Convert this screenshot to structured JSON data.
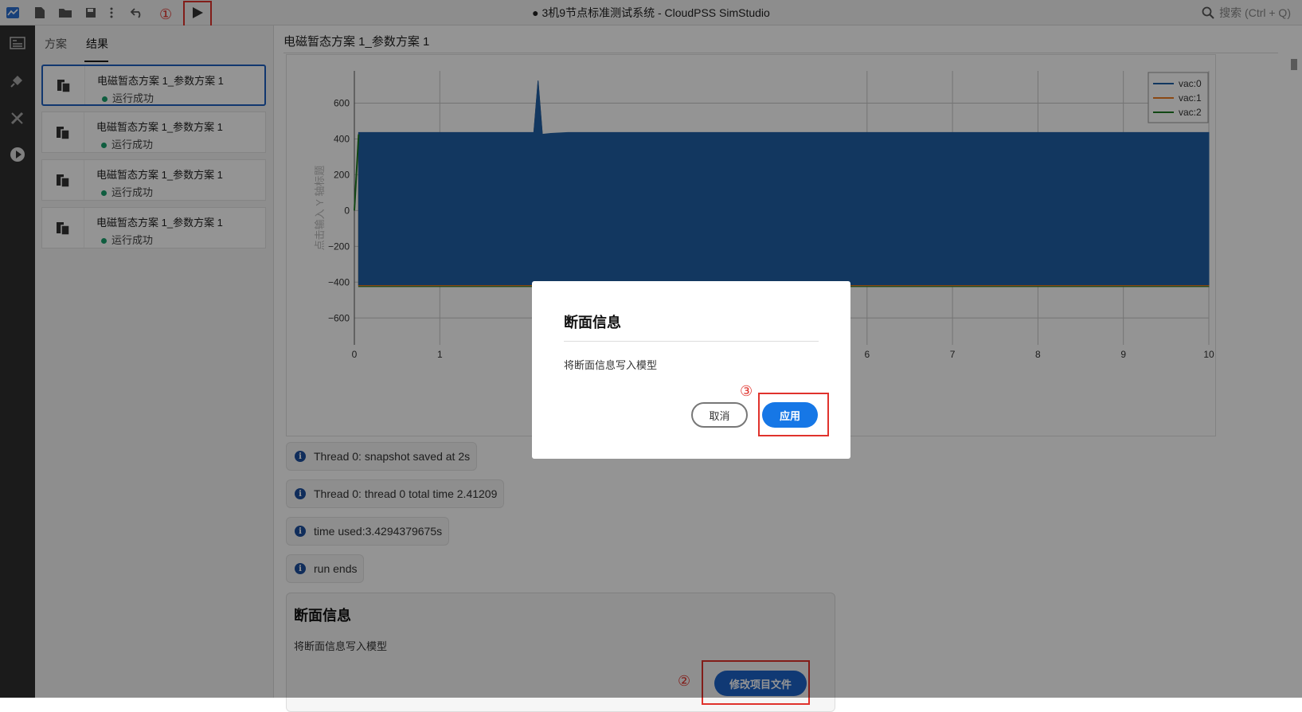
{
  "app": {
    "title": "● 3机9节点标准测试系统 - CloudPSS SimStudio",
    "search_placeholder": "搜索 (Ctrl + Q)"
  },
  "toolbar": {
    "annotation": "①"
  },
  "left_panel": {
    "tabs": [
      {
        "label": "方案"
      },
      {
        "label": "结果"
      }
    ],
    "results": [
      {
        "name": "电磁暂态方案 1_参数方案 1",
        "status": "运行成功"
      },
      {
        "name": "电磁暂态方案 1_参数方案 1",
        "status": "运行成功"
      },
      {
        "name": "电磁暂态方案 1_参数方案 1",
        "status": "运行成功"
      },
      {
        "name": "电磁暂态方案 1_参数方案 1",
        "status": "运行成功"
      }
    ]
  },
  "main": {
    "title": "电磁暂态方案 1_参数方案 1",
    "logs": [
      {
        "text": "Thread 0: snapshot saved at 2s"
      },
      {
        "text": "Thread 0: thread 0 total time 2.41209"
      },
      {
        "text": "time used:3.4294379675s"
      },
      {
        "text": "run ends"
      }
    ],
    "snapshot_card": {
      "title": "断面信息",
      "text": "将断面信息写入模型",
      "button": "修改项目文件",
      "annotation": "②"
    }
  },
  "chart_data": {
    "type": "line",
    "ylabel": "点击输入 Y 轴标题",
    "xlim": [
      0,
      10
    ],
    "ylim": [
      -750,
      780
    ],
    "x_ticks": [
      0,
      1,
      6,
      7,
      8,
      9,
      10
    ],
    "y_ticks": [
      600,
      400,
      200,
      0,
      -200,
      -400,
      -600
    ],
    "x_tick_labels": [
      "0",
      "1",
      "6",
      "7",
      "8",
      "9",
      "10"
    ],
    "y_tick_labels": [
      "600",
      "400",
      "200",
      "0",
      "−200",
      "−400",
      "−600"
    ],
    "legend": "top-right",
    "grid": true,
    "series": [
      {
        "name": "vac:0",
        "color": "#1f5fa6",
        "envelope": {
          "x": [
            0.05,
            2.1,
            2.15,
            2.2,
            2.3,
            2.5,
            10
          ],
          "upper": [
            425,
            425,
            715,
            415,
            420,
            425,
            425
          ],
          "lower": [
            -425,
            -425,
            -425,
            -425,
            -425,
            -425,
            -425
          ]
        }
      },
      {
        "name": "vac:1",
        "color": "#ef7d22",
        "envelope": {
          "x": [
            0.05,
            2.1,
            2.15,
            2.2,
            2.3,
            2.5,
            10
          ],
          "upper": [
            425,
            425,
            715,
            415,
            420,
            425,
            425
          ],
          "lower": [
            -425,
            -425,
            -425,
            -425,
            -425,
            -425,
            -425
          ]
        }
      },
      {
        "name": "vac:2",
        "color": "#1e7a24",
        "envelope": {
          "x": [
            0.05,
            2.1,
            2.15,
            2.2,
            2.3,
            2.5,
            10
          ],
          "upper": [
            425,
            425,
            715,
            415,
            420,
            425,
            425
          ],
          "lower": [
            -425,
            -425,
            -425,
            -425,
            -425,
            -425,
            -425
          ]
        }
      }
    ]
  },
  "modal": {
    "title": "断面信息",
    "text": "将断面信息写入模型",
    "cancel": "取消",
    "apply": "应用",
    "annotation": "③"
  }
}
